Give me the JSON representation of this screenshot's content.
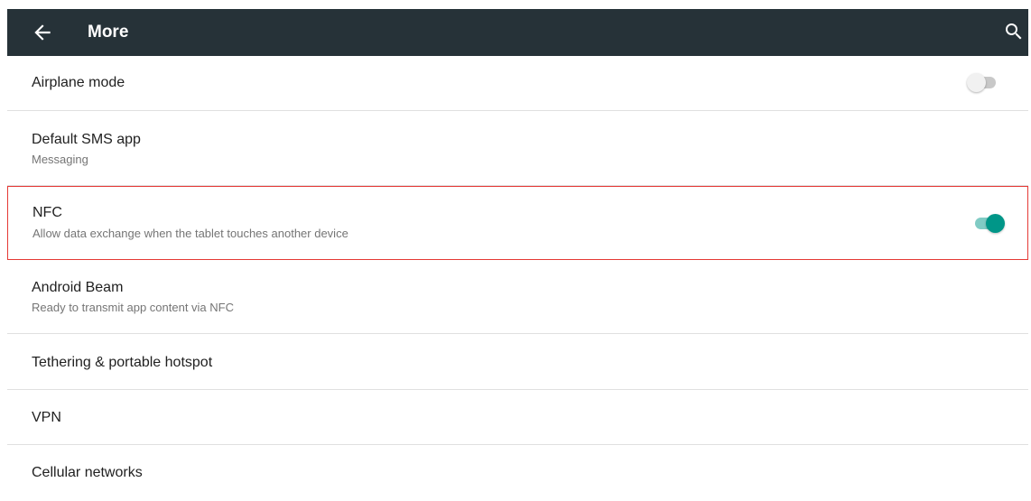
{
  "toolbar": {
    "title": "More",
    "back_icon": "arrow-back-icon",
    "search_icon": "search-icon",
    "background_color": "#263238"
  },
  "items": [
    {
      "title": "Airplane mode",
      "summary": "",
      "toggle": "off"
    },
    {
      "title": "Default SMS app",
      "summary": "Messaging"
    },
    {
      "title": "NFC",
      "summary": "Allow data exchange when the tablet touches another device",
      "toggle": "on",
      "highlighted": true
    },
    {
      "title": "Android Beam",
      "summary": "Ready to transmit app content via NFC"
    },
    {
      "title": "Tethering & portable hotspot",
      "summary": ""
    },
    {
      "title": "VPN",
      "summary": ""
    },
    {
      "title": "Cellular networks",
      "summary": ""
    }
  ],
  "colors": {
    "accent": "#009688",
    "accent_track": "#80cbc4",
    "highlight_border": "#e53935",
    "divider": "#e0e0e0"
  }
}
